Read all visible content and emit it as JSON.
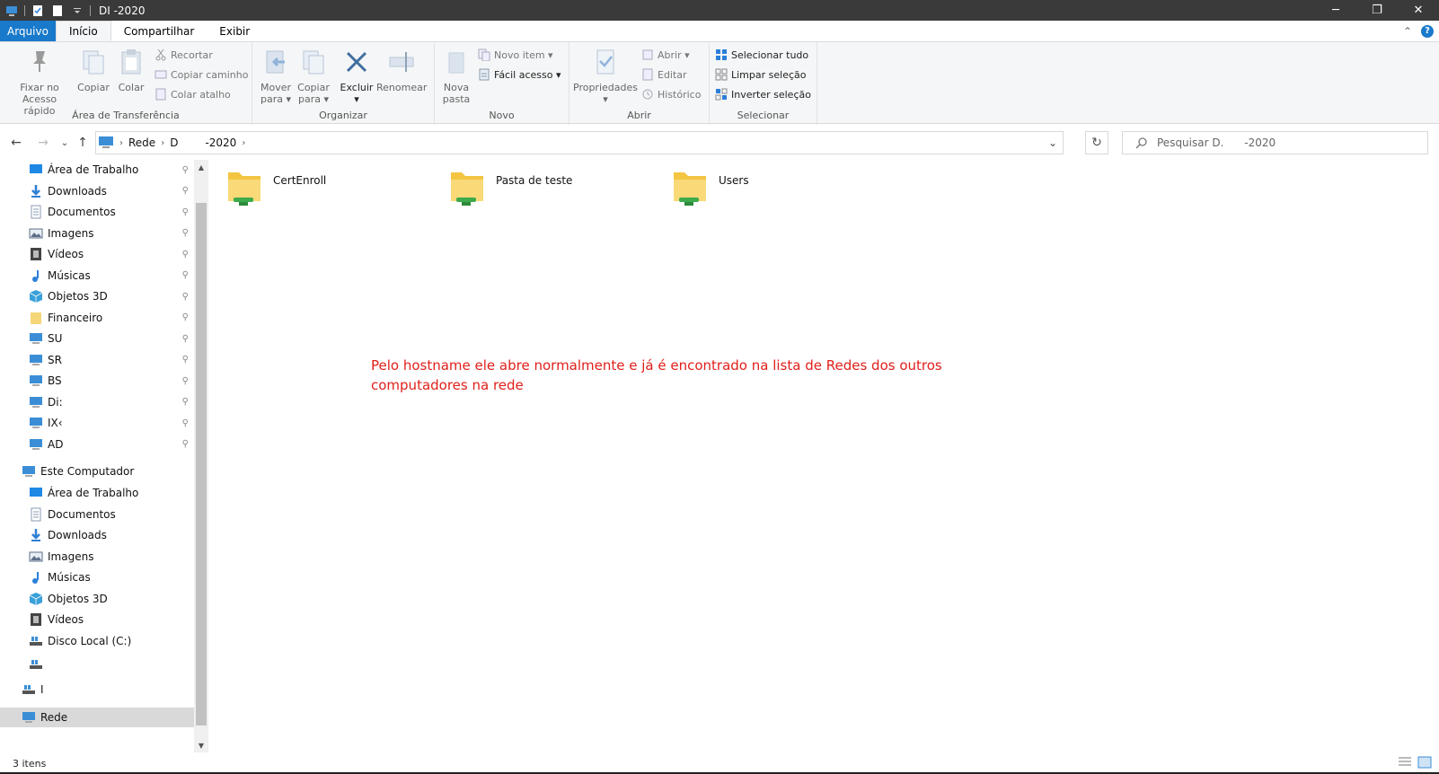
{
  "window": {
    "title": "DI   -2020",
    "minimize_glyph": "─",
    "maximize_glyph": "❐",
    "close_glyph": "✕"
  },
  "tabs": {
    "file": "Arquivo",
    "home": "Início",
    "share": "Compartilhar",
    "view": "Exibir",
    "help_glyph": "?",
    "collapse_glyph": "⌃"
  },
  "ribbon": {
    "clipboard": {
      "label": "Área de Transferência",
      "pin_line1": "Fixar no",
      "pin_line2": "Acesso rápido",
      "copy": "Copiar",
      "paste": "Colar",
      "cut": "Recortar",
      "copy_path": "Copiar caminho",
      "paste_shortcut": "Colar atalho"
    },
    "organize": {
      "label": "Organizar",
      "move_line1": "Mover",
      "move_line2": "para ▾",
      "copyto_line1": "Copiar",
      "copyto_line2": "para ▾",
      "delete_line1": "Excluir",
      "delete_line2": "▾",
      "rename": "Renomear"
    },
    "new": {
      "label": "Novo",
      "new_folder_line1": "Nova",
      "new_folder_line2": "pasta",
      "new_item": "Novo item ▾",
      "easy_access": "Fácil acesso ▾"
    },
    "open": {
      "label": "Abrir",
      "properties_line1": "Propriedades",
      "properties_line2": "▾",
      "open": "Abrir ▾",
      "edit": "Editar",
      "history": "Histórico"
    },
    "select": {
      "label": "Selecionar",
      "select_all": "Selecionar tudo",
      "select_none": "Limpar seleção",
      "invert": "Inverter seleção"
    }
  },
  "address": {
    "back_glyph": "←",
    "forward_glyph": "→",
    "recent_glyph": "⌄",
    "up_glyph": "↑",
    "crumbs": [
      "Rede",
      "D",
      "-2020"
    ],
    "sep_glyph": "›",
    "dropdown_glyph": "⌄",
    "refresh_glyph": "↻",
    "search_placeholder": "Pesquisar D.      -2020"
  },
  "nav": {
    "pin_glyph": "📌",
    "quick_access": [
      {
        "label": "Área de Trabalho",
        "icon": "desktop-icon",
        "color": "#1e88e5"
      },
      {
        "label": "Downloads",
        "icon": "download-icon",
        "color": "#2f7fd4"
      },
      {
        "label": "Documentos",
        "icon": "document-icon",
        "color": "#8a9bb0"
      },
      {
        "label": "Imagens",
        "icon": "pictures-icon",
        "color": "#5b6f86"
      },
      {
        "label": "Vídeos",
        "icon": "videos-icon",
        "color": "#444"
      },
      {
        "label": "Músicas",
        "icon": "music-icon",
        "color": "#2b7fd9"
      },
      {
        "label": "Objetos 3D",
        "icon": "objects-3d-icon",
        "color": "#3aa0d8"
      },
      {
        "label": "Financeiro",
        "icon": "folder-icon",
        "color": "#f5d77a"
      },
      {
        "label": "SU",
        "icon": "computer-icon",
        "color": "#3b8ed6"
      },
      {
        "label": "SR",
        "icon": "computer-icon",
        "color": "#3b8ed6"
      },
      {
        "label": "BS",
        "icon": "computer-icon",
        "color": "#3b8ed6"
      },
      {
        "label": "Di:",
        "icon": "computer-icon",
        "color": "#3b8ed6"
      },
      {
        "label": "IX‹",
        "icon": "computer-icon",
        "color": "#3b8ed6"
      },
      {
        "label": "AD",
        "icon": "computer-icon",
        "color": "#3b8ed6"
      }
    ],
    "this_pc": "Este Computador",
    "this_pc_items": [
      {
        "label": "Área de Trabalho",
        "icon": "desktop-icon",
        "color": "#1e88e5"
      },
      {
        "label": "Documentos",
        "icon": "document-icon",
        "color": "#8a9bb0"
      },
      {
        "label": "Downloads",
        "icon": "download-icon",
        "color": "#2f7fd4"
      },
      {
        "label": "Imagens",
        "icon": "pictures-icon",
        "color": "#5b6f86"
      },
      {
        "label": "Músicas",
        "icon": "music-icon",
        "color": "#2b7fd9"
      },
      {
        "label": "Objetos 3D",
        "icon": "objects-3d-icon",
        "color": "#3aa0d8"
      },
      {
        "label": "Vídeos",
        "icon": "videos-icon",
        "color": "#444"
      },
      {
        "label": "Disco Local (C:)",
        "icon": "drive-icon",
        "color": "#555"
      }
    ],
    "drive_1": "",
    "drive_2": "I",
    "network": "Rede"
  },
  "content": {
    "folders": [
      {
        "name": "CertEnroll"
      },
      {
        "name": "Pasta de teste"
      },
      {
        "name": "Users"
      }
    ],
    "annotation": "Pelo hostname ele abre normalmente e já é encontrado na lista de Redes dos outros computadores na rede",
    "annotation_color": "#e0201b"
  },
  "status": {
    "count": "3 itens"
  },
  "colors": {
    "accent": "#1979ca",
    "titlebar": "#3a3a3a",
    "ribbon_bg": "#f5f6f7",
    "selected_nav": "#d9d9d9"
  }
}
